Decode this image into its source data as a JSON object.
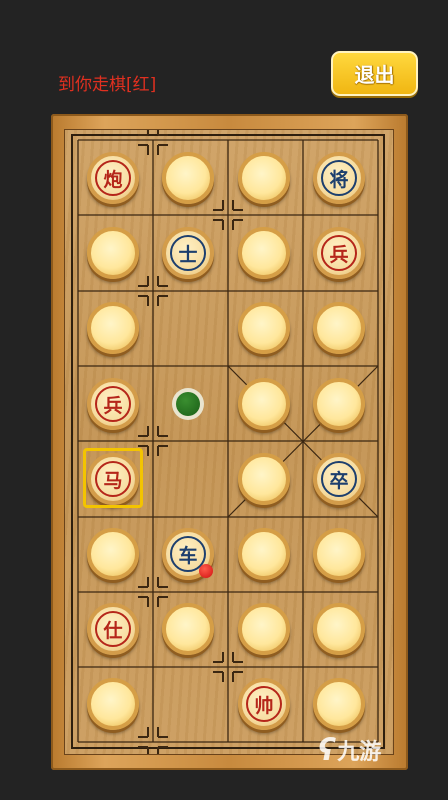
{
  "status": {
    "turn_text": "到你走棋[红]"
  },
  "toolbar": {
    "exit_label": "退出"
  },
  "board": {
    "rows": 8,
    "cols": 4,
    "pieces": [
      [
        "炮",
        "",
        "",
        "将"
      ],
      [
        "",
        "士",
        "",
        "兵"
      ],
      [
        "",
        "",
        "",
        ""
      ],
      [
        "兵",
        null,
        "",
        ""
      ],
      [
        "马",
        null,
        "",
        "卒"
      ],
      [
        "",
        "车",
        "",
        ""
      ],
      [
        "仕",
        "",
        "",
        ""
      ],
      [
        "",
        null,
        "帅",
        ""
      ]
    ],
    "sides": [
      [
        "red",
        "blank",
        "blank",
        "blue"
      ],
      [
        "blank",
        "blue",
        "blank",
        "red"
      ],
      [
        "blank",
        "none",
        "blank",
        "blank"
      ],
      [
        "red",
        "none",
        "blank",
        "blank"
      ],
      [
        "red",
        "none",
        "blank",
        "blue"
      ],
      [
        "blank",
        "blue",
        "blank",
        "blank"
      ],
      [
        "red",
        "blank",
        "blank",
        "blank"
      ],
      [
        "blank",
        "none",
        "red",
        "blank"
      ]
    ],
    "selected": {
      "row": 4,
      "col": 0
    },
    "move_hint": {
      "row": 3,
      "col": 1
    },
    "last_moved": {
      "row": 5,
      "col": 1
    }
  },
  "colors": {
    "red": "#b5261a",
    "blue": "#1d3f6e",
    "highlight": "#f3c400"
  },
  "watermark": {
    "logo": "九游"
  }
}
